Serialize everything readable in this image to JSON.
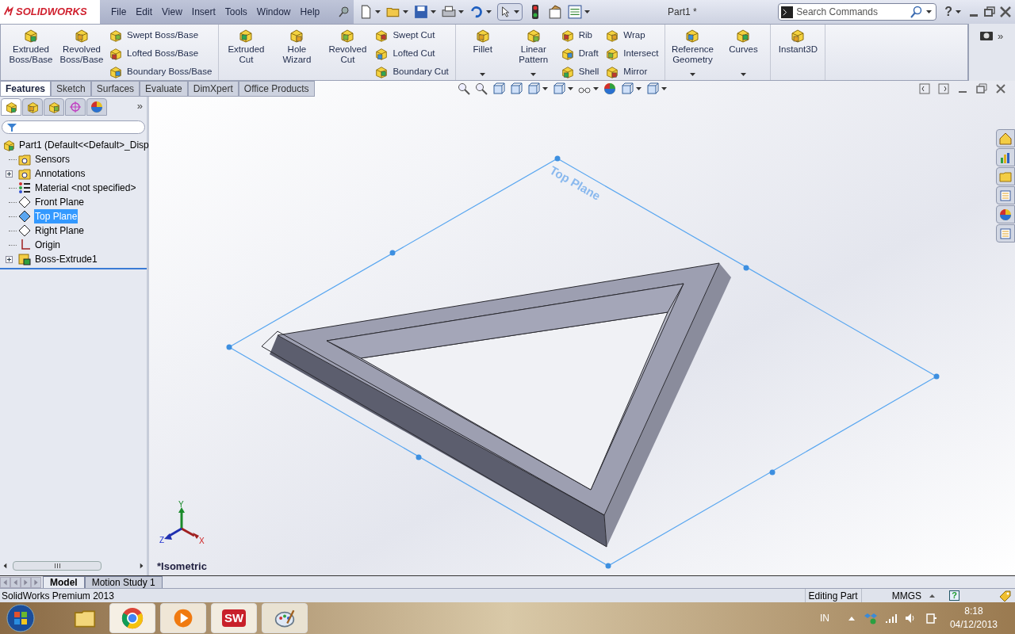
{
  "app_logo": "SOLIDWORKS",
  "menu": [
    "File",
    "Edit",
    "View",
    "Insert",
    "Tools",
    "Window",
    "Help"
  ],
  "title": "Part1 *",
  "search": {
    "placeholder": "Search Commands"
  },
  "help_glyph": "?",
  "ribbon": {
    "groups": [
      [
        {
          "kind": "large",
          "label": "Extruded Boss/Base",
          "dropdown": false
        },
        {
          "kind": "large",
          "label": "Revolved Boss/Base",
          "dropdown": false
        },
        {
          "kind": "stack",
          "items": [
            "Swept Boss/Base",
            "Lofted Boss/Base",
            "Boundary Boss/Base"
          ]
        }
      ],
      [
        {
          "kind": "large",
          "label": "Extruded Cut",
          "dropdown": false
        },
        {
          "kind": "large",
          "label": "Hole Wizard",
          "dropdown": false
        },
        {
          "kind": "large",
          "label": "Revolved Cut",
          "dropdown": false
        },
        {
          "kind": "stack",
          "items": [
            "Swept Cut",
            "Lofted Cut",
            "Boundary Cut"
          ]
        }
      ],
      [
        {
          "kind": "large",
          "label": "Fillet",
          "dropdown": true
        },
        {
          "kind": "large",
          "label": "Linear Pattern",
          "dropdown": true
        },
        {
          "kind": "stack",
          "items": [
            "Rib",
            "Draft",
            "Shell"
          ]
        },
        {
          "kind": "stack",
          "items": [
            "Wrap",
            "Intersect",
            "Mirror"
          ]
        }
      ],
      [
        {
          "kind": "large",
          "label": "Reference Geometry",
          "dropdown": true
        },
        {
          "kind": "large",
          "label": "Curves",
          "dropdown": true
        }
      ],
      [
        {
          "kind": "large",
          "label": "Instant3D",
          "dropdown": false
        }
      ]
    ]
  },
  "more_glyph": "»",
  "command_tabs": [
    {
      "label": "Features",
      "selected": true
    },
    {
      "label": "Sketch",
      "selected": false
    },
    {
      "label": "Surfaces",
      "selected": false
    },
    {
      "label": "Evaluate",
      "selected": false
    },
    {
      "label": "DimXpert",
      "selected": false
    },
    {
      "label": "Office Products",
      "selected": false
    }
  ],
  "panel_tabs": [
    {
      "selected": true
    },
    {
      "selected": false
    },
    {
      "selected": false
    },
    {
      "selected": false
    },
    {
      "selected": false
    }
  ],
  "panel_more": "»",
  "tree": {
    "label": "Part1  (Default<<Default>_Disp",
    "children": [
      {
        "label": "Sensors",
        "has_children": false,
        "selected": false
      },
      {
        "label": "Annotations",
        "has_children": true,
        "selected": false
      },
      {
        "label": "Material <not specified>",
        "has_children": false,
        "selected": false
      },
      {
        "label": "Front Plane",
        "has_children": false,
        "selected": false
      },
      {
        "label": "Top Plane",
        "has_children": false,
        "selected": true
      },
      {
        "label": "Right Plane",
        "has_children": false,
        "selected": false
      },
      {
        "label": "Origin",
        "has_children": false,
        "selected": false
      },
      {
        "label": "Boss-Extrude1",
        "has_children": true,
        "selected": false
      }
    ]
  },
  "viewport": {
    "plane_label": "Top Plane",
    "view_label": "*Isometric",
    "triad": {
      "x": "X",
      "y": "Y",
      "z": "Z"
    }
  },
  "bottom_tabs": [
    {
      "label": "Model",
      "selected": true
    },
    {
      "label": "Motion Study 1",
      "selected": false
    }
  ],
  "status": {
    "product": "SolidWorks Premium 2013",
    "mode": "Editing Part",
    "units": "MMGS",
    "help_glyph": "?"
  },
  "taskbar": {
    "app_badge": "SW",
    "language": "IN",
    "time": "8:18",
    "date": "04/12/2013"
  }
}
